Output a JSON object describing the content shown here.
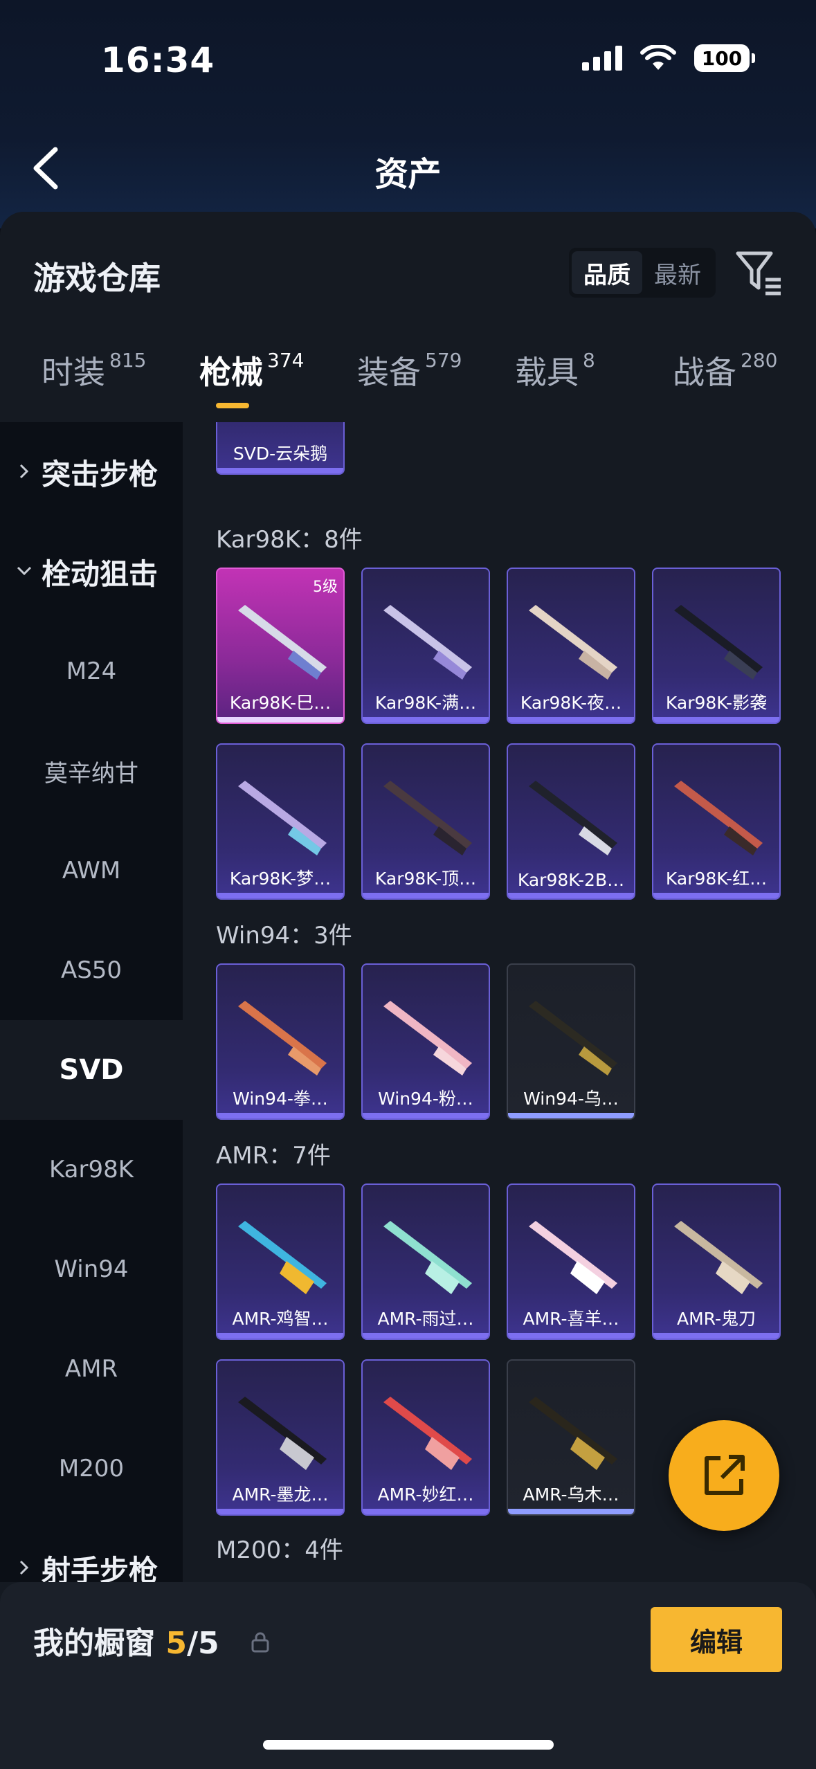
{
  "status": {
    "time": "16:34",
    "battery": "100"
  },
  "nav": {
    "title": "资产"
  },
  "panel": {
    "title": "游戏仓库",
    "sort_options": [
      "品质",
      "最新"
    ]
  },
  "tabs": [
    {
      "label": "时装",
      "count": "815"
    },
    {
      "label": "枪械",
      "count": "374"
    },
    {
      "label": "装备",
      "count": "579"
    },
    {
      "label": "载具",
      "count": "8"
    },
    {
      "label": "战备",
      "count": "280"
    }
  ],
  "sidebar": {
    "groups": [
      "突击步枪",
      "栓动狙击",
      "射手步枪"
    ],
    "items": [
      "M24",
      "莫辛纳甘",
      "AWM",
      "AS50",
      "SVD",
      "Kar98K",
      "Win94",
      "AMR",
      "M200"
    ]
  },
  "sections": [
    {
      "title": "Kar98K：8件"
    },
    {
      "title": "Win94：3件"
    },
    {
      "title": "AMR：7件"
    },
    {
      "title": "M200：4件"
    }
  ],
  "cards": {
    "svd": [
      "SVD-云朵鹅"
    ],
    "kar98k": [
      "Kar98K-巳…",
      "Kar98K-满…",
      "Kar98K-夜…",
      "Kar98K-影袭",
      "Kar98K-梦…",
      "Kar98K-顶…",
      "Kar98K-2B…",
      "Kar98K-红…"
    ],
    "kar98k_level": "5级",
    "win94": [
      "Win94-拳…",
      "Win94-粉…",
      "Win94-乌…"
    ],
    "amr": [
      "AMR-鸡智…",
      "AMR-雨过…",
      "AMR-喜羊…",
      "AMR-鬼刀",
      "AMR-墨龙…",
      "AMR-妙红…",
      "AMR-乌木…"
    ]
  },
  "showcase": {
    "title": "我的橱窗",
    "current": "5",
    "total": "/5"
  },
  "edit_label": "编辑",
  "colors": {
    "accent": "#f7b731",
    "card_purple": "#332b72",
    "card_gold": "#c233b5",
    "panel": "#151a22"
  }
}
